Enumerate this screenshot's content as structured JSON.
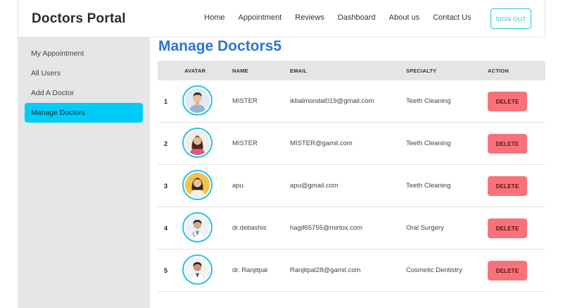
{
  "header": {
    "brand": "Doctors Portal",
    "nav": [
      "Home",
      "Appointment",
      "Reviews",
      "Dashboard",
      "About us",
      "Contact Us"
    ],
    "signout_label": "SIGN OUT"
  },
  "sidebar": {
    "items": [
      {
        "label": "My Appointment",
        "active": false
      },
      {
        "label": "All Users",
        "active": false
      },
      {
        "label": "Add A Doctor",
        "active": false
      },
      {
        "label": "Manage Doctors",
        "active": true
      }
    ]
  },
  "main": {
    "title": "Manage Doctors5",
    "columns": [
      "AVATAR",
      "NAME",
      "EMAIL",
      "SPECIALTY",
      "ACTION"
    ],
    "rows": [
      {
        "index": "1",
        "name": "MISTER",
        "email": "ikbalmondal019@gmail.com",
        "specialty": "Teeth Cleaning",
        "action": "DELETE"
      },
      {
        "index": "2",
        "name": "MISTER",
        "email": "MISTER@gamil.com",
        "specialty": "Teeth Cleaning",
        "action": "DELETE"
      },
      {
        "index": "3",
        "name": "apu",
        "email": "apu@gmail.com",
        "specialty": "Teeth Cleaning",
        "action": "DELETE"
      },
      {
        "index": "4",
        "name": "dr.debashis",
        "email": "hagif65755@mirtox.com",
        "specialty": "Oral Surgery",
        "action": "DELETE"
      },
      {
        "index": "5",
        "name": "dr. Ranjitpal",
        "email": "Ranjitpal28@gamil.com",
        "specialty": "Cosmetic Dentistry",
        "action": "DELETE"
      }
    ]
  },
  "colors": {
    "accent": "#27c3dd",
    "title": "#2d74d6",
    "active_sidebar": "#00cdf7",
    "delete": "#f8727a"
  }
}
